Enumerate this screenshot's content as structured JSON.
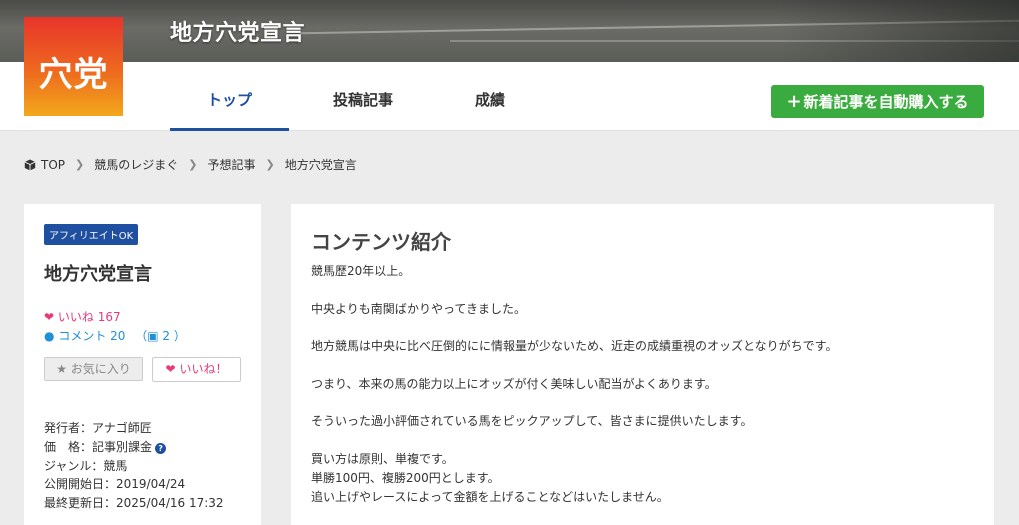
{
  "header": {
    "site_title": "地方穴党宣言",
    "logo_text": "穴党",
    "tabs": [
      {
        "label": "トップ",
        "active": true
      },
      {
        "label": "投稿記事",
        "active": false
      },
      {
        "label": "成績",
        "active": false
      }
    ],
    "buy_button": {
      "icon": "plus-icon",
      "label": "新着記事を自動購入する"
    }
  },
  "breadcrumb": [
    "TOP",
    "競馬のレジまぐ",
    "予想記事",
    "地方穴党宣言"
  ],
  "sidebar": {
    "badge": "アフィリエイトOK",
    "title": "地方穴党宣言",
    "likes_text": "いいね 167",
    "comments_text": "コメント 20",
    "gifts_text": "2",
    "favorite_label": "お気に入り",
    "like_label": "いいね！",
    "meta": {
      "publisher": "発行者：アナゴ師匠",
      "price": "価　格：記事別課金",
      "genre": "ジャンル：競馬",
      "start_date": "公開開始日：2019/04/24",
      "updated": "最終更新日：2025/04/16 17:32"
    }
  },
  "main": {
    "title": "コンテンツ紹介",
    "paragraphs": [
      "競馬歴20年以上。",
      "中央よりも南関ばかりやってきました。",
      "地方競馬は中央に比べ圧倒的にに情報量が少ないため、近走の成績重視のオッズとなりがちです。",
      "つまり、本来の馬の能力以上にオッズが付く美味しい配当がよくあります。",
      "そういった過小評価されている馬をピックアップして、皆さまに提供いたします。",
      "買い方は原則、単複です。",
      "単勝100円、複勝200円とします。",
      "追い上げやレースによって金額を上げることなどはいたしません。"
    ]
  },
  "colors": {
    "accent": "#1e4fa0",
    "buy_green": "#3aab3e",
    "like_pink": "#e83a7a",
    "comment_blue": "#1e8fd8"
  }
}
